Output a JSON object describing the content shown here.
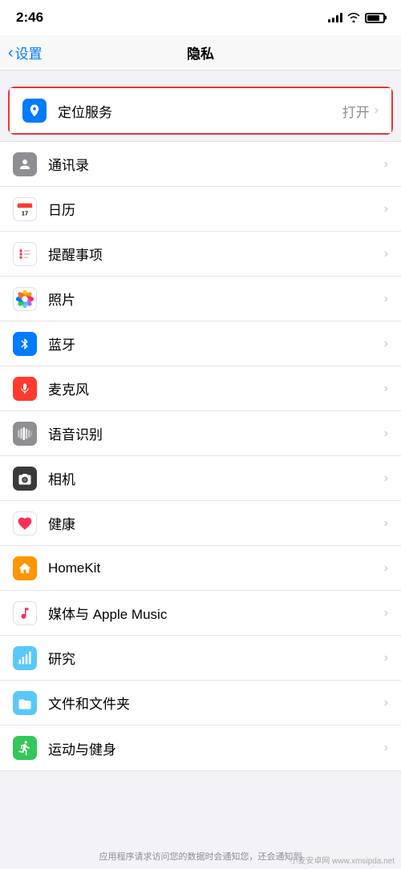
{
  "statusBar": {
    "time": "2:46",
    "batteryLevel": 80
  },
  "navBar": {
    "backLabel": "设置",
    "title": "隐私"
  },
  "listItems": [
    {
      "id": "location",
      "label": "定位服务",
      "value": "打开",
      "icon": "location-icon",
      "iconBg": "#007aff",
      "highlighted": true
    },
    {
      "id": "contacts",
      "label": "通讯录",
      "value": "",
      "icon": "contacts-icon",
      "iconBg": "#8e8e93",
      "highlighted": false
    },
    {
      "id": "calendar",
      "label": "日历",
      "value": "",
      "icon": "calendar-icon",
      "iconBg": "#ff3b30",
      "highlighted": false
    },
    {
      "id": "reminders",
      "label": "提醒事项",
      "value": "",
      "icon": "reminders-icon",
      "iconBg": "#ff3b30",
      "highlighted": false
    },
    {
      "id": "photos",
      "label": "照片",
      "value": "",
      "icon": "photos-icon",
      "iconBg": "gradient",
      "highlighted": false
    },
    {
      "id": "bluetooth",
      "label": "蓝牙",
      "value": "",
      "icon": "bluetooth-icon",
      "iconBg": "#007aff",
      "highlighted": false
    },
    {
      "id": "microphone",
      "label": "麦克风",
      "value": "",
      "icon": "microphone-icon",
      "iconBg": "#ff3b30",
      "highlighted": false
    },
    {
      "id": "speech",
      "label": "语音识别",
      "value": "",
      "icon": "speech-icon",
      "iconBg": "#8e8e93",
      "highlighted": false
    },
    {
      "id": "camera",
      "label": "相机",
      "value": "",
      "icon": "camera-icon",
      "iconBg": "#3a3a3c",
      "highlighted": false
    },
    {
      "id": "health",
      "label": "健康",
      "value": "",
      "icon": "health-icon",
      "iconBg": "#fff",
      "highlighted": false
    },
    {
      "id": "homekit",
      "label": "HomeKit",
      "value": "",
      "icon": "homekit-icon",
      "iconBg": "#ff9500",
      "highlighted": false
    },
    {
      "id": "media",
      "label": "媒体与 Apple Music",
      "value": "",
      "icon": "music-icon",
      "iconBg": "#fff",
      "highlighted": false
    },
    {
      "id": "research",
      "label": "研究",
      "value": "",
      "icon": "research-icon",
      "iconBg": "#5ac8fa",
      "highlighted": false
    },
    {
      "id": "files",
      "label": "文件和文件夹",
      "value": "",
      "icon": "files-icon",
      "iconBg": "#5ac8fa",
      "highlighted": false
    },
    {
      "id": "fitness",
      "label": "运动与健身",
      "value": "",
      "icon": "fitness-icon",
      "iconBg": "#34c759",
      "highlighted": false
    }
  ],
  "bottomHint": "应用程序请求访问您的数据时会通知您，还会通知到",
  "watermark": "小麦安卓网 www.xmsipda.net"
}
